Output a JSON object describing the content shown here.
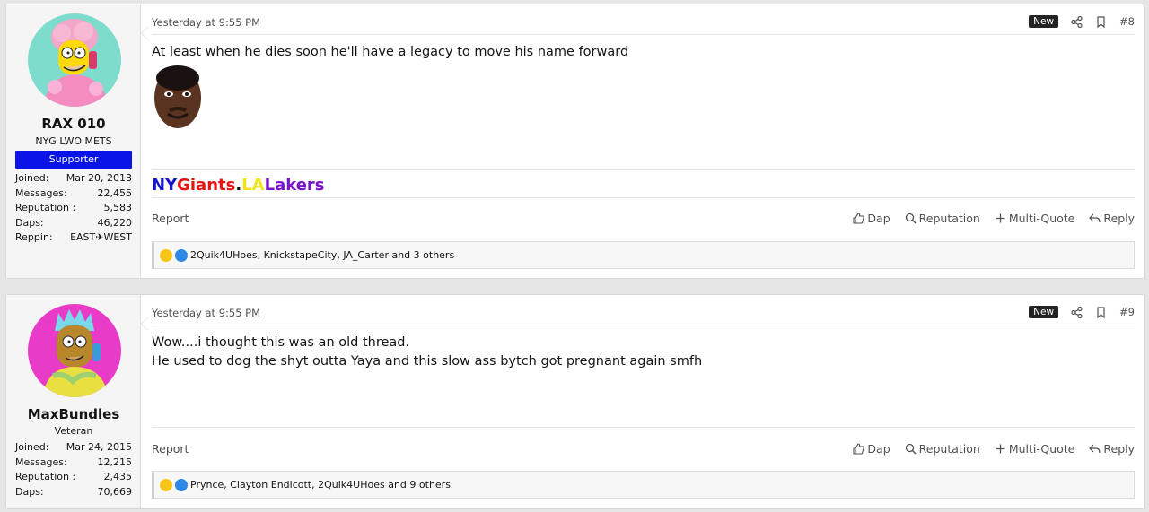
{
  "posts": [
    {
      "user": {
        "name": "RAX 010",
        "title": "NYG LWO METS",
        "banner": "Supporter",
        "stats": [
          {
            "label": "Joined:",
            "value": "Mar 20, 2013"
          },
          {
            "label": "Messages:",
            "value": "22,455"
          },
          {
            "label": "Reputation :",
            "value": "5,583"
          },
          {
            "label": "Daps:",
            "value": "46,220"
          },
          {
            "label": "Reppin:",
            "value": "EAST✈WEST"
          }
        ]
      },
      "date": "Yesterday at 9:55 PM",
      "new_label": "New",
      "post_number": "#8",
      "message_lines": [
        "At least when he dies soon he'll have a legacy to move his name forward"
      ],
      "signature": [
        {
          "text": "NY",
          "color": "#1414d2"
        },
        {
          "text": "Giants",
          "color": "#e61414"
        },
        {
          "text": ".",
          "color": "#141414"
        },
        {
          "text": "LA",
          "color": "#f0e614"
        },
        {
          "text": "Lakers",
          "color": "#7814c8"
        }
      ],
      "report": "Report",
      "actions": [
        "Dap",
        "Reputation",
        "Multi-Quote",
        "Reply"
      ],
      "reactions": "2Quik4UHoes, KnickstapeCity, JA_Carter and 3 others"
    },
    {
      "user": {
        "name": "MaxBundles",
        "title": "Veteran",
        "stats": [
          {
            "label": "Joined:",
            "value": "Mar 24, 2015"
          },
          {
            "label": "Messages:",
            "value": "12,215"
          },
          {
            "label": "Reputation :",
            "value": "2,435"
          },
          {
            "label": "Daps:",
            "value": "70,669"
          }
        ]
      },
      "date": "Yesterday at 9:55 PM",
      "new_label": "New",
      "post_number": "#9",
      "message_lines": [
        "Wow....i thought this was an old thread.",
        "He used to dog the shyt outta Yaya and this slow ass bytch got pregnant again smfh"
      ],
      "report": "Report",
      "actions": [
        "Dap",
        "Reputation",
        "Multi-Quote",
        "Reply"
      ],
      "reactions": "Prynce, Clayton Endicott, 2Quik4UHoes and 9 others"
    }
  ],
  "colors": {
    "supporter_banner": "#0a14e6",
    "avatar1_bg": "#7ddccc",
    "avatar2_bg": "#e83cc8"
  },
  "icons": {
    "share": "share-icon",
    "bookmark": "bookmark-icon",
    "dap": "thumbs-up-icon",
    "reputation": "search-icon",
    "multiquote": "plus-icon",
    "reply": "reply-icon"
  }
}
